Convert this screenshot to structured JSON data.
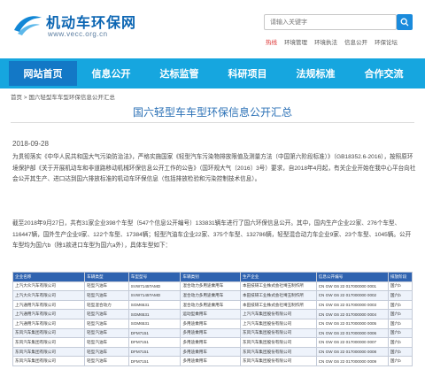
{
  "site": {
    "name": "机动车环保网",
    "url": "www.vecc.org.cn"
  },
  "search": {
    "placeholder": "请输入关键字"
  },
  "top_nav": [
    "热线",
    "环境管理",
    "环境执法",
    "信息公开",
    "环保论坛"
  ],
  "main_nav": [
    "网站首页",
    "信息公开",
    "达标监管",
    "科研项目",
    "法规标准",
    "合作交流"
  ],
  "breadcrumb": "首页 > 国六轻型车车型环保信息公开汇总",
  "article": {
    "title": "国六轻型车车型环保信息公开汇总",
    "date": "2018-09-28",
    "paragraph1": "为贯彻落实《中华人民共和国大气污染防治法》，严格实施国家《轻型汽车污染物排放限值及测量方法（中国第六阶段标准）》（GB18352.6-2016），按照原环境保护部《关于开展机动车和非道路移动机械环保信息公开工作的公告》（国环规大气〔2016〕3号）要求，自2018年4月起，有关企业开始在我中心平台向社会公开其生产、进口达到国六排放标准的机动车环保信息（包括排放检验和污染控制技术信息）。",
    "paragraph2": "截至2018年9月27日，共有31家企业398个车型（547个信息公开编号）133831辆车进行了国六环保信息公开。其中，国内生产企业22家、276个车型、116447辆，国外生产企业9家、122个车型、17384辆；轻型汽油车企业22家、375个车型、132786辆，轻型混合动力车企业9家、23个车型、1045辆。公开车型均为国六b（除1款进口车型为国六a外），具体车型如下："
  },
  "table": {
    "headers": [
      "企业名称",
      "车辆类型",
      "车型型号",
      "车辆类别",
      "生产企业",
      "信息公开编号",
      "排放阶段"
    ],
    "rows": [
      [
        "上汽大众汽车有限公司",
        "轻型汽油车",
        "SVW7145TAMD",
        "混合动力多用途乘用车",
        "本田技研工业株式会社埼玉制作所",
        "CN GW G6 22 017000000 0001",
        "国六b"
      ],
      [
        "上汽大众汽车有限公司",
        "轻型汽油车",
        "SVW7145TAMD",
        "混合动力多用途乘用车",
        "本田技研工业株式会社埼玉制作所",
        "CN GW G6 22 017000000 0002",
        "国六b"
      ],
      [
        "上汽通用汽车有限公司",
        "轻型混合动力",
        "SGM6531",
        "混合动力多用途乘用车",
        "本田技研工业株式会社埼玉制作所",
        "CN GW G6 22 017000000 0003",
        "国六b"
      ],
      [
        "上汽通用汽车有限公司",
        "轻型汽油车",
        "SGM6531",
        "运动型乘用车",
        "上汽汽车集团股份有限公司",
        "CN GW G6 22 017000000 0004",
        "国六b"
      ],
      [
        "上汽通用汽车有限公司",
        "轻型汽油车",
        "SGM6531",
        "多用途乘用车",
        "上汽汽车集团股份有限公司",
        "CN GW G6 22 017000000 0005",
        "国六b"
      ],
      [
        "东风汽车集团有限公司",
        "轻型汽油车",
        "DFM7151",
        "多用途乘用车",
        "东风汽车集团股份有限公司",
        "CN GW G6 22 017000000 0006",
        "国六b"
      ],
      [
        "东风汽车集团有限公司",
        "轻型汽油车",
        "DFM7151",
        "多用途乘用车",
        "东风汽车集团股份有限公司",
        "CN GW G6 22 017000000 0007",
        "国六b"
      ],
      [
        "东风汽车集团有限公司",
        "轻型汽油车",
        "DFM7151",
        "多用途乘用车",
        "东风汽车集团股份有限公司",
        "CN GW G6 22 017000000 0008",
        "国六b"
      ],
      [
        "东风汽车集团有限公司",
        "轻型汽油车",
        "DFM7151",
        "多用途乘用车",
        "东风汽车集团股份有限公司",
        "CN GW G6 22 017000000 0009",
        "国六b"
      ]
    ]
  }
}
